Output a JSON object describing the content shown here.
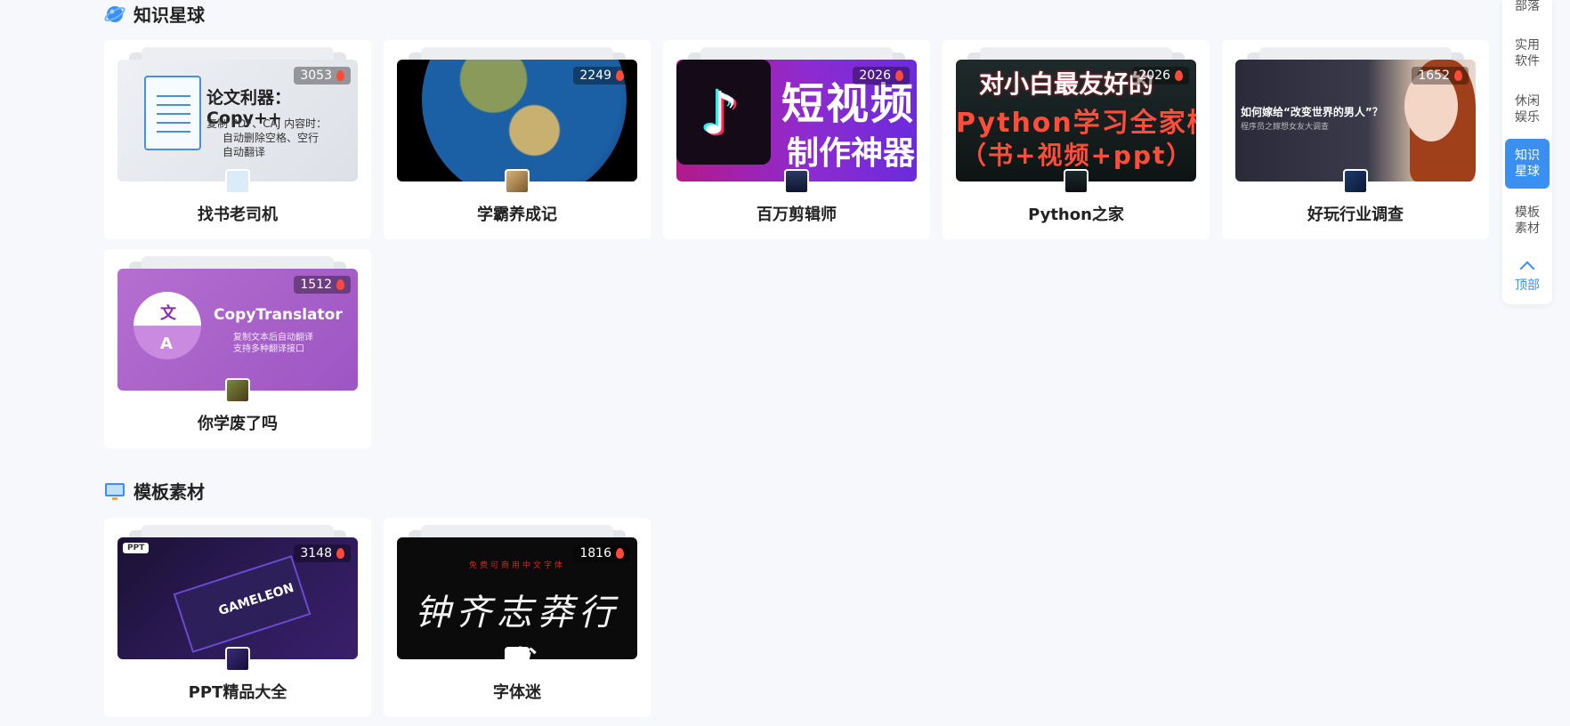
{
  "sections": [
    {
      "title": "知识星球",
      "icon": "planet-icon",
      "cards": [
        {
          "title": "找书老司机",
          "count": "3053",
          "thumb_text": [
            "论文利器：Copy++",
            "复制 PDF、CAJ 内容时：",
            "自动删除空格、空行",
            "自动翻译"
          ]
        },
        {
          "title": "学霸养成记",
          "count": "2249"
        },
        {
          "title": "百万剪辑师",
          "count": "2026",
          "thumb_text": [
            "短视频",
            "制作神器"
          ]
        },
        {
          "title": "Python之家",
          "count": "2026",
          "thumb_text": [
            "对小白最友好的",
            "Python学习全家桶",
            "（书+视频+ppt）"
          ]
        },
        {
          "title": "好玩行业调查",
          "count": "1652",
          "thumb_text": [
            "如何嫁给“改变世界的男人”？",
            "程序员之嫁想女友大调查"
          ]
        },
        {
          "title": "你学废了吗",
          "count": "1512",
          "thumb_text": [
            "文",
            "A",
            "CopyTranslator",
            "复制文本后自动翻译",
            "支持多种翻译接口"
          ]
        }
      ]
    },
    {
      "title": "模板素材",
      "icon": "monitor-icon",
      "cards": [
        {
          "title": "PPT精品大全",
          "count": "3148",
          "thumb_text": [
            "PPT",
            "GAMELEON"
          ]
        },
        {
          "title": "字体迷",
          "count": "1816",
          "thumb_text": [
            "免费可商用中文字体",
            "钟齐志莽行书"
          ]
        }
      ]
    }
  ],
  "sidenav": {
    "items": [
      "部落",
      "实用\n软件",
      "休闲\n娱乐",
      "知识\n星球",
      "模板\n素材"
    ],
    "active": "知识\n星球",
    "top_label": "顶部"
  },
  "colors": {
    "accent": "#3a8ff0",
    "fire": "#ff4a3a",
    "background": "#f6f8fb"
  }
}
